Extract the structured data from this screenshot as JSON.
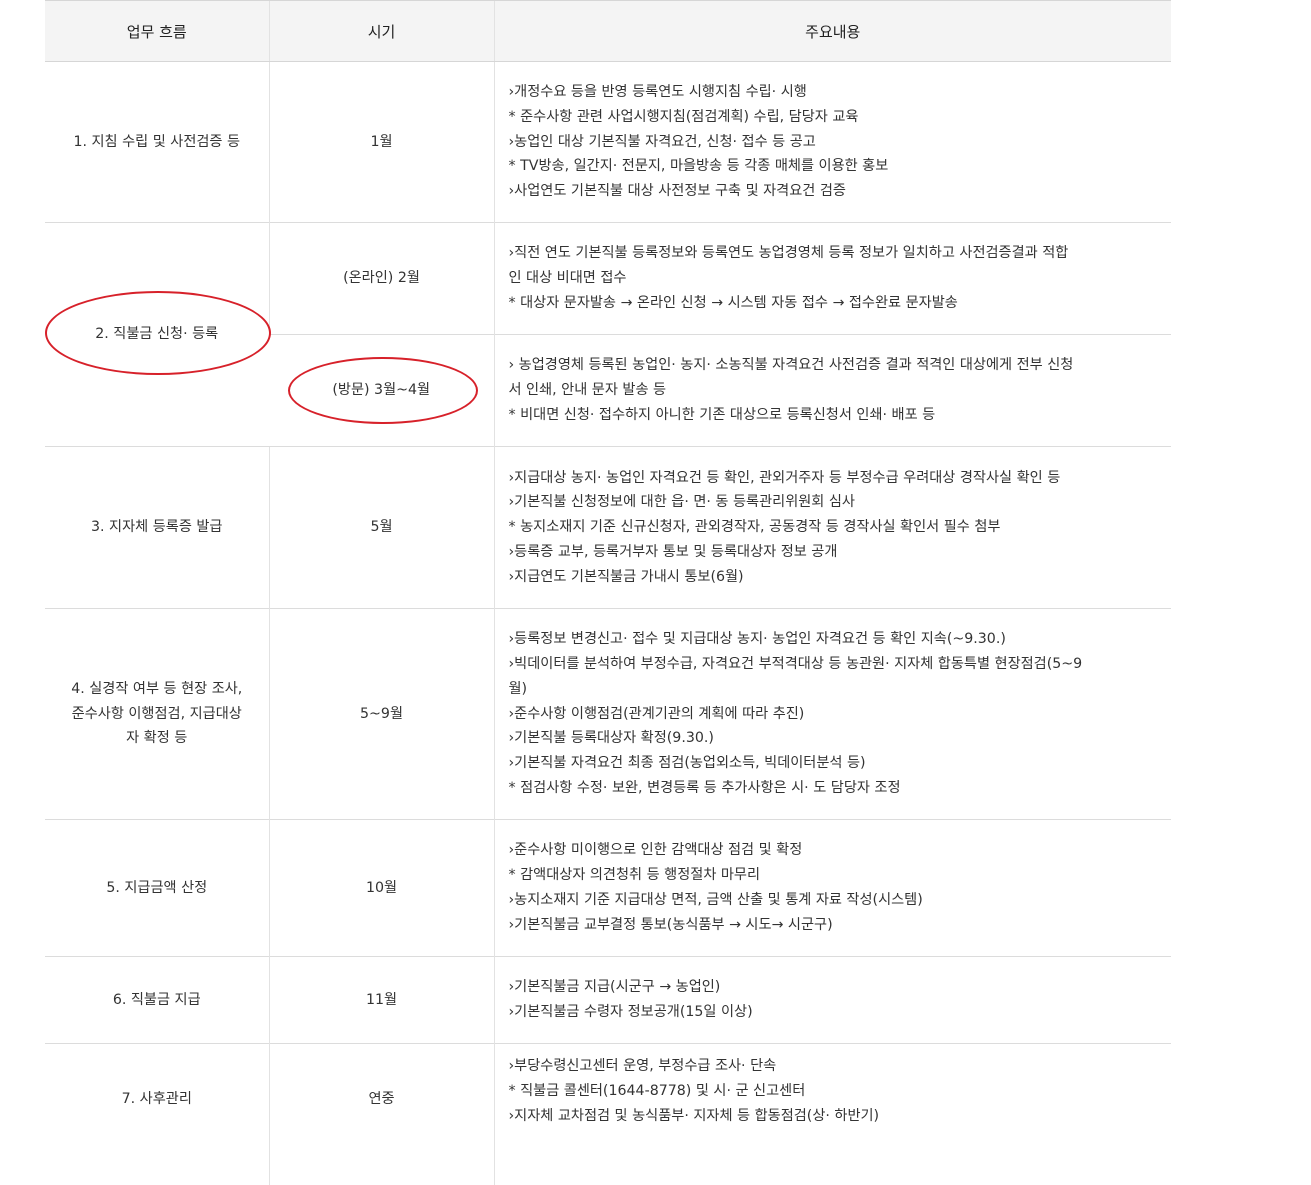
{
  "headers": [
    "업무 흐름",
    "시기",
    "주요내용"
  ],
  "rows": [
    {
      "stage": "1. 지침 수립 및 사전검증 등",
      "period": "1월",
      "content": [
        "›개정수요 등을 반영 등록연도 시행지침 수립· 시행",
        "* 준수사항 관련 사업시행지침(점검계획) 수립, 담당자 교육",
        "›농업인 대상 기본직불 자격요건, 신청· 접수 등 공고",
        "* TV방송, 일간지· 전문지, 마을방송 등 각종 매체를 이용한 홍보",
        "›사업연도 기본직불 대상 사전정보 구축 및 자격요건 검증"
      ]
    },
    {
      "stage": "2. 직불금 신청· 등록",
      "sub": [
        {
          "period": "(온라인) 2월",
          "content": [
            "›직전 연도 기본직불 등록정보와 등록연도 농업경영체 등록 정보가 일치하고 사전검증결과 적합",
            "인 대상 비대면 접수",
            "* 대상자 문자발송 → 온라인 신청 → 시스템 자동 접수 → 접수완료 문자발송"
          ]
        },
        {
          "period": "(방문) 3월~4월",
          "content": [
            "› 농업경영체 등록된 농업인· 농지· 소농직불 자격요건 사전검증 결과 적격인 대상에게 전부 신청",
            "서 인쇄, 안내 문자 발송 등",
            "* 비대면 신청· 접수하지 아니한 기존 대상으로 등록신청서 인쇄· 배포 등"
          ]
        }
      ]
    },
    {
      "stage": "3. 지자체 등록증 발급",
      "period": "5월",
      "content": [
        "›지급대상 농지· 농업인 자격요건 등 확인, 관외거주자 등 부정수급 우려대상 경작사실 확인 등",
        "›기본직불 신청정보에 대한 읍· 면· 동 등록관리위원회 심사",
        "* 농지소재지 기준 신규신청자, 관외경작자, 공동경작 등 경작사실 확인서 필수 첨부",
        "›등록증 교부, 등록거부자 통보 및 등록대상자 정보 공개",
        "›지급연도 기본직불금 가내시 통보(6월)"
      ]
    },
    {
      "stage_lines": [
        "4. 실경작 여부 등 현장 조사,",
        "준수사항 이행점검, 지급대상",
        "자 확정 등"
      ],
      "period": "5~9월",
      "content": [
        "›등록정보 변경신고· 접수 및 지급대상 농지· 농업인 자격요건 등 확인 지속(~9.30.)",
        "›빅데이터를 분석하여 부정수급, 자격요건 부적격대상 등 농관원· 지자체 합동특별 현장점검(5~9",
        "월)",
        "›준수사항 이행점검(관계기관의 계획에 따라 추진)",
        "›기본직불 등록대상자 확정(9.30.)",
        "›기본직불 자격요건 최종 점검(농업외소득, 빅데이터분석 등)",
        "* 점검사항 수정· 보완, 변경등록 등 추가사항은 시· 도 담당자 조정"
      ]
    },
    {
      "stage": "5. 지급금액 산정",
      "period": "10월",
      "content": [
        "›준수사항 미이행으로 인한 감액대상 점검 및 확정",
        "* 감액대상자 의견청취 등 행정절차 마무리",
        "›농지소재지 기준 지급대상 면적, 금액 산출 및 통계 자료 작성(시스템)",
        "›기본직불금 교부결정 통보(농식품부 → 시도→ 시군구)"
      ]
    },
    {
      "stage": "6. 직불금 지급",
      "period": "11월",
      "content": [
        "›기본직불금 지급(시군구 → 농업인)",
        "›기본직불금 수령자 정보공개(15일 이상)"
      ]
    },
    {
      "stage": "7. 사후관리",
      "period": "연중",
      "content": [
        "›부당수령신고센터 운영, 부정수급 조사· 단속",
        "* 직불금 콜센터(1644-8778) 및 시· 군 신고센터",
        "›지자체 교차점검 및 농식품부· 지자체 등 합동점검(상· 하반기)"
      ]
    }
  ],
  "colors": {
    "header_bg": "#f4f4f4",
    "border": "#dcdcdc",
    "highlight": "#d7212a",
    "text": "#333333"
  }
}
